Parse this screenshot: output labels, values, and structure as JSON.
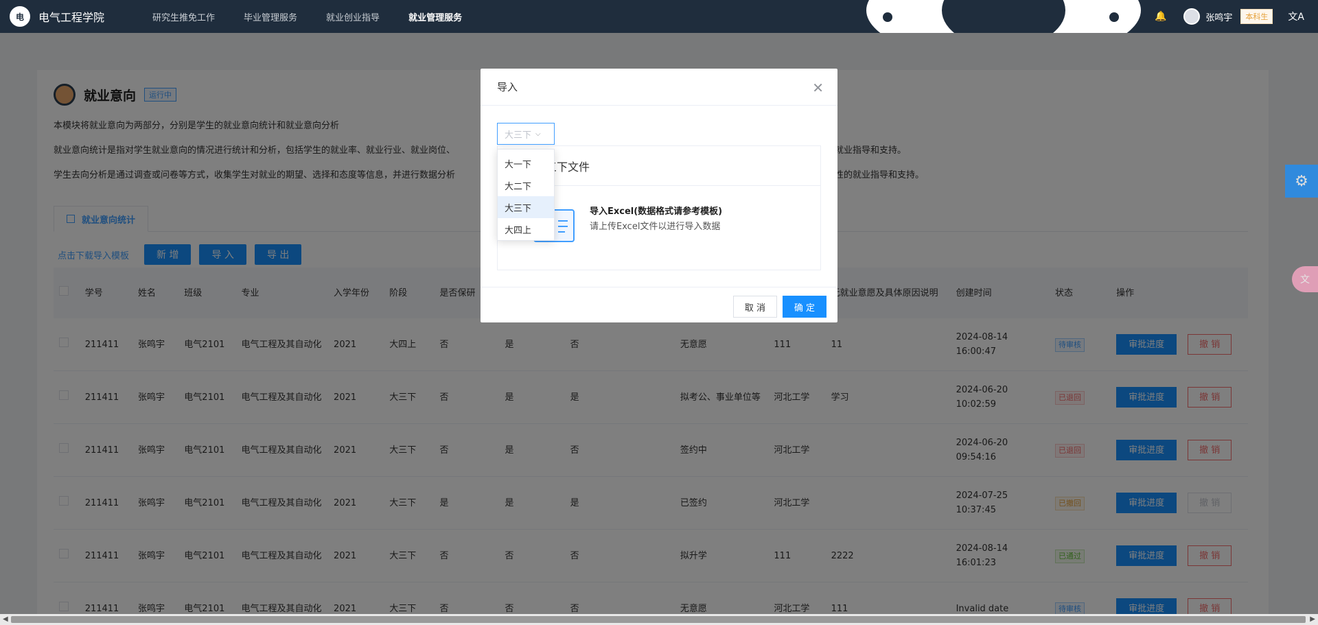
{
  "header": {
    "brand": "电气工程学院",
    "logo_text": "电",
    "nav": [
      "研究生推免工作",
      "毕业管理服务",
      "就业创业指导",
      "就业管理服务"
    ],
    "user": "张鸣宇",
    "role": "本科生"
  },
  "module": {
    "title": "就业意向",
    "status": "运行中",
    "desc1": "本模块将就业意向为两部分，分别是学生的就业意向统计和就业意向分析",
    "desc2": "就业意向统计是指对学生就业意向的情况进行统计和分析，包括学生的就业率、就业行业、就业岗位、",
    "desc2_tail": "就业指导和支持。",
    "desc3": "学生去向分析是通过调查或问卷等方式，收集学生对就业的期望、选择和态度等信息，并进行数据分析",
    "desc3_tail": "性的就业指导和支持。"
  },
  "tab": "就业意向统计",
  "toolbar": {
    "template_link": "点击下载导入模板",
    "add": "新 增",
    "import": "导 入",
    "export": "导 出"
  },
  "table": {
    "headers": [
      "学号",
      "姓名",
      "班级",
      "专业",
      "入学年份",
      "阶段",
      "是否保研",
      "",
      "",
      "",
      "",
      "无就业意愿及具体原因说明",
      "创建时间",
      "状态",
      "操作"
    ],
    "rows": [
      {
        "id": "211411",
        "name": "张鸣宇",
        "cls": "电气2101",
        "major": "电气工程及其自动化",
        "year": "2021",
        "stage": "大四上",
        "a": "否",
        "b": "是",
        "c": "否",
        "intent": "无意愿",
        "place": "111",
        "reason": "11",
        "time": "2024-08-14 16:00:47",
        "status": "待审核",
        "status_type": "pending",
        "revoke_disabled": false
      },
      {
        "id": "211411",
        "name": "张鸣宇",
        "cls": "电气2101",
        "major": "电气工程及其自动化",
        "year": "2021",
        "stage": "大三下",
        "a": "否",
        "b": "是",
        "c": "是",
        "intent": "拟考公、事业单位等",
        "place": "河北工学",
        "reason": "学习",
        "time": "2024-06-20 10:02:59",
        "status": "已退回",
        "status_type": "returned",
        "revoke_disabled": false
      },
      {
        "id": "211411",
        "name": "张鸣宇",
        "cls": "电气2101",
        "major": "电气工程及其自动化",
        "year": "2021",
        "stage": "大三下",
        "a": "否",
        "b": "是",
        "c": "否",
        "intent": "签约中",
        "place": "河北工学",
        "reason": "",
        "time": "2024-06-20 09:54:16",
        "status": "已退回",
        "status_type": "returned",
        "revoke_disabled": false
      },
      {
        "id": "211411",
        "name": "张鸣宇",
        "cls": "电气2101",
        "major": "电气工程及其自动化",
        "year": "2021",
        "stage": "大三下",
        "a": "是",
        "b": "是",
        "c": "是",
        "intent": "已签约",
        "place": "河北工学",
        "reason": "",
        "time": "2024-07-25 10:37:45",
        "status": "已撤回",
        "status_type": "withdrawn",
        "revoke_disabled": true
      },
      {
        "id": "211411",
        "name": "张鸣宇",
        "cls": "电气2101",
        "major": "电气工程及其自动化",
        "year": "2021",
        "stage": "大三下",
        "a": "否",
        "b": "否",
        "c": "否",
        "intent": "拟升学",
        "place": "111",
        "reason": "2222",
        "time": "2024-08-14 16:01:23",
        "status": "已通过",
        "status_type": "passed",
        "revoke_disabled": false
      },
      {
        "id": "211411",
        "name": "张鸣宇",
        "cls": "电气2101",
        "major": "电气工程及其自动化",
        "year": "2021",
        "stage": "大三下",
        "a": "否",
        "b": "否",
        "c": "否",
        "intent": "无意愿",
        "place": "河北工学",
        "reason": "111",
        "time": "Invalid date",
        "status": "待审核",
        "status_type": "pending",
        "revoke_disabled": false
      }
    ],
    "btn_progress": "审批进度",
    "btn_revoke": "撤 销"
  },
  "dialog": {
    "title": "导入",
    "select_value": "大三下",
    "upload_head": "三下文件",
    "upload_title": "导入Excel(数据格式请参考模板)",
    "upload_desc": "请上传Excel文件以进行导入数据",
    "cancel": "取 消",
    "ok": "确 定",
    "options": [
      "大一下",
      "大二下",
      "大三下",
      "大四上"
    ],
    "selected_index": 2
  }
}
